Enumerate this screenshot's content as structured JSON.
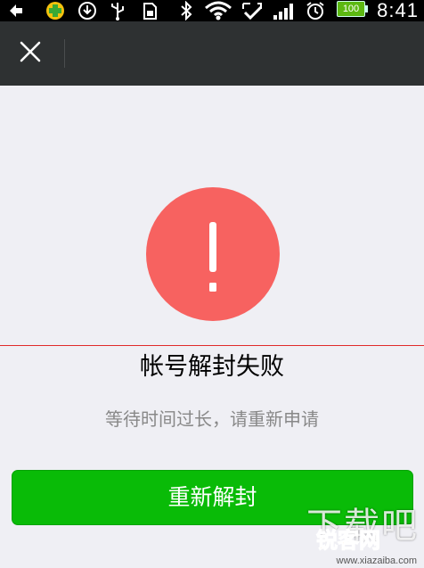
{
  "status_bar": {
    "time": "8:41",
    "battery": "100",
    "icons": [
      "back-arrow-icon",
      "plus-badge-icon",
      "download-icon",
      "usb-icon",
      "sim-icon",
      "bluetooth-icon",
      "wifi-icon",
      "sync-check-icon",
      "signal-icon",
      "alarm-icon",
      "battery-icon"
    ]
  },
  "navbar": {
    "close_icon": "close-icon"
  },
  "main": {
    "status_icon": "exclamation-icon",
    "status_color": "#f76260",
    "title": "帐号解封失败",
    "subtitle": "等待时间过长，请重新申请",
    "button_label": "重新解封",
    "button_color": "#09bb07"
  },
  "watermark": {
    "big_text": "下载吧",
    "logo_text": "锐客网",
    "url": "www.xiazaiba.com"
  }
}
